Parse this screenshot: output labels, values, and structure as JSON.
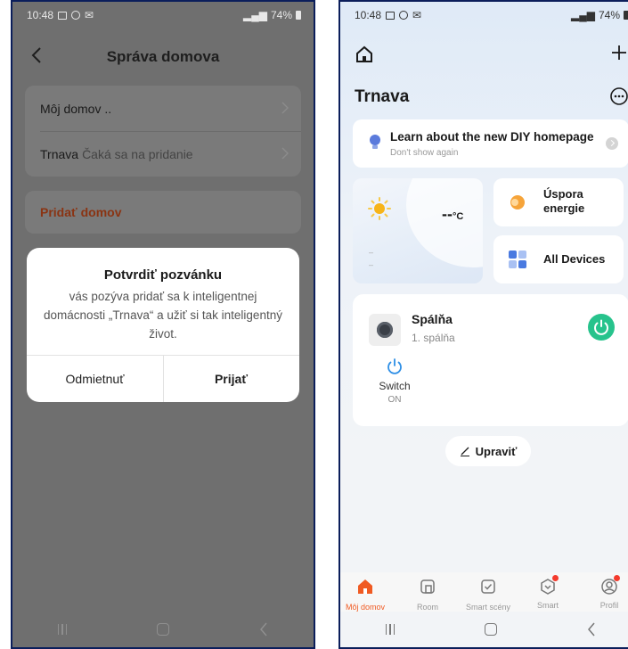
{
  "left_screen": {
    "status_bar": {
      "time": "10:48",
      "battery": "74%"
    },
    "nav": {
      "title": "Správa domova"
    },
    "home_list": [
      {
        "name": "Môj domov ..",
        "sub": ""
      },
      {
        "name": "Trnava",
        "sub": "Čaká sa na pridanie"
      }
    ],
    "add_home_label": "Pridať domov",
    "dialog": {
      "title": "Potvrdiť pozvánku",
      "body": "vás pozýva pridať sa k inteligentnej domácnosti „Trnava“ a užiť si tak inteligentný život.",
      "decline_label": "Odmietnuť",
      "accept_label": "Prijať"
    }
  },
  "right_screen": {
    "status_bar": {
      "time": "10:48",
      "battery": "74%"
    },
    "home_name": "Trnava",
    "banner": {
      "title": "Learn about the new DIY homepage",
      "subtitle": "Don't show again"
    },
    "weather": {
      "temperature": "--",
      "unit": "°C",
      "line1": "–",
      "line2": "–"
    },
    "tiles": {
      "energy": [
        "Úspora",
        "energie"
      ],
      "devices": "All Devices"
    },
    "device": {
      "name": "Spálňa",
      "room": "1. spálňa",
      "switch_label": "Switch",
      "switch_state": "ON"
    },
    "edit_label": "Upraviť",
    "tabs": [
      {
        "label": "Môj domov",
        "icon": "home-icon",
        "active": true,
        "badge": false
      },
      {
        "label": "Room",
        "icon": "room-icon",
        "active": false,
        "badge": false
      },
      {
        "label": "Smart scény",
        "icon": "scene-check-icon",
        "active": false,
        "badge": false
      },
      {
        "label": "Smart",
        "icon": "smart-icon",
        "active": false,
        "badge": true
      },
      {
        "label": "Profil",
        "icon": "profile-icon",
        "active": false,
        "badge": true
      }
    ]
  },
  "colors": {
    "accent": "#f05a22",
    "power_green": "#27c38c",
    "add_home_red": "#8a3413",
    "frame": "#0b1e5b"
  }
}
